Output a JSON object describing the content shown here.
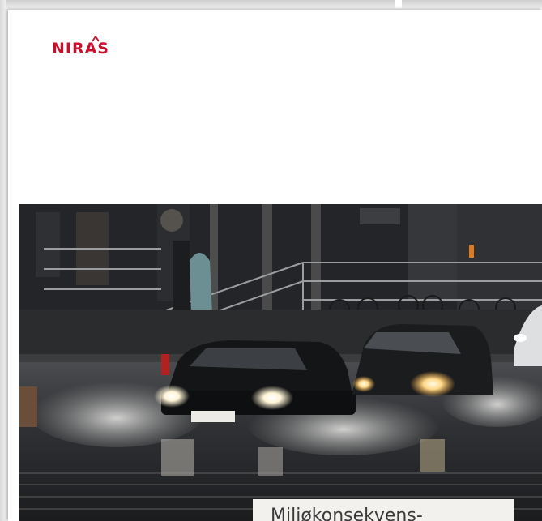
{
  "brand": {
    "logo_text": "NIRAS",
    "brand_color": "#c8102e"
  },
  "cover": {
    "caption": "Miljøkonsekvens-",
    "photo_subject": "cars-driving-through-flooded-street-at-night-image"
  },
  "colors": {
    "page_background": "#ffffff",
    "caption_background": "#f3f1ee",
    "caption_text": "#3a3a3a"
  }
}
